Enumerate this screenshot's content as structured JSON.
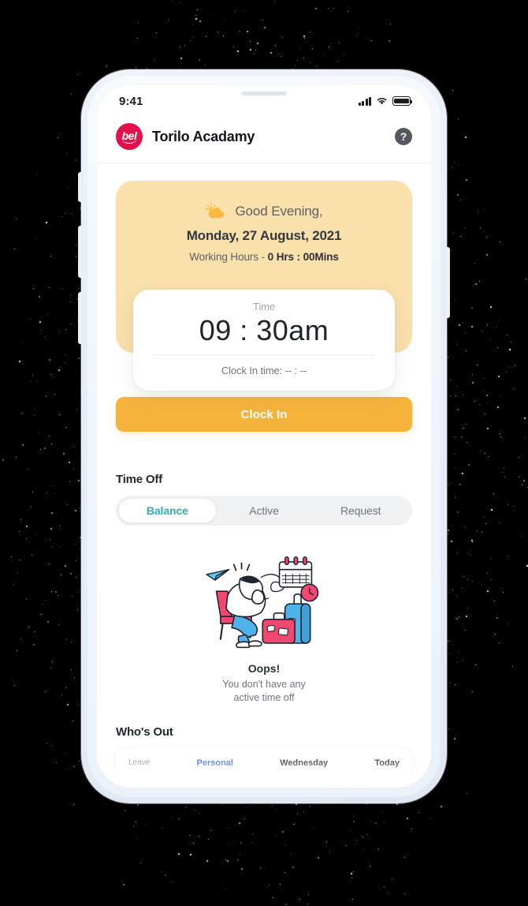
{
  "status_bar": {
    "time": "9:41",
    "signal_icon": "cellular-signal-icon",
    "wifi_icon": "wifi-icon",
    "battery_icon": "battery-icon"
  },
  "header": {
    "logo_text": "bel",
    "logo_name": "bel-logo",
    "org_name": "Torilo Acadamy",
    "help_label": "?",
    "help_name": "help-icon"
  },
  "greeting": {
    "weather_icon": "sun-behind-cloud-icon",
    "salutation": "Good Evening,",
    "date": "Monday, 27 August, 2021",
    "working_hours_label": "Working Hours - ",
    "working_hours_value": "0 Hrs : 00Mins"
  },
  "time_card": {
    "label": "Time",
    "value": "09 : 30am",
    "clock_in_label": "Clock In time:  -- : --"
  },
  "actions": {
    "clock_in_label": "Clock In"
  },
  "time_off": {
    "title": "Time Off",
    "tabs": [
      {
        "label": "Balance",
        "active": true
      },
      {
        "label": "Active",
        "active": false
      },
      {
        "label": "Request",
        "active": false
      }
    ],
    "empty_state": {
      "illustration": "sad-traveler-with-luggage-illustration",
      "title": "Oops!",
      "message": "You don't have any\nactive time off"
    }
  },
  "whos_out": {
    "title": "Who's Out",
    "row": {
      "type_label": "Leave",
      "type_value": "Personal",
      "day_label": "Wednesday",
      "when_label": "Today"
    }
  },
  "colors": {
    "accent_yellow": "#f5b33c",
    "card_yellow": "#fae0ab",
    "brand_crimson": "#e3114b",
    "tab_teal": "#3aa9b4",
    "text_dark": "#20242b",
    "background": "#000000"
  }
}
